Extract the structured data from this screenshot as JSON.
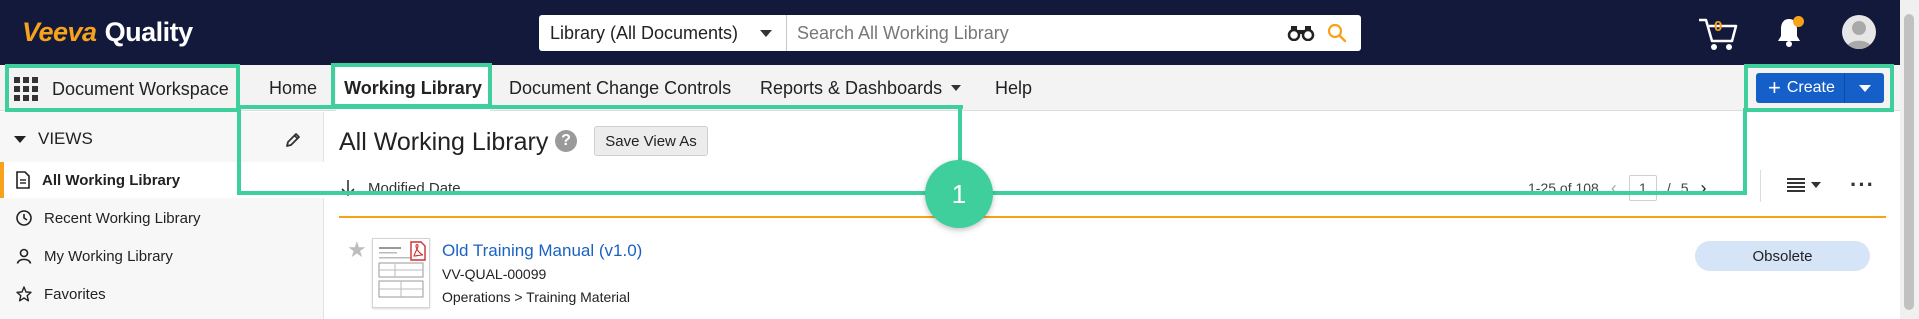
{
  "header": {
    "brand": "Veeva",
    "product": "Quality",
    "search_scope": "Library (All Documents)",
    "search_placeholder": "Search All Working Library",
    "cart_count": "0",
    "accent": "#f7a21b",
    "bg": "#12193a"
  },
  "nav": {
    "workspace_label": "Document Workspace",
    "items": [
      {
        "label": "Home"
      },
      {
        "label": "Working Library"
      },
      {
        "label": "Document Change Controls"
      },
      {
        "label": "Reports & Dashboards"
      },
      {
        "label": "Help"
      }
    ],
    "create_label": "Create"
  },
  "sidebar": {
    "views_label": "VIEWS",
    "items": [
      {
        "label": "All Working Library",
        "icon": "document-icon"
      },
      {
        "label": "Recent Working Library",
        "icon": "clock-icon"
      },
      {
        "label": "My Working Library",
        "icon": "person-icon"
      },
      {
        "label": "Favorites",
        "icon": "star-icon"
      }
    ]
  },
  "main": {
    "title": "All Working Library",
    "save_view_label": "Save View As",
    "sort_label": "Modified Date",
    "pager": {
      "range": "1-25 of 108",
      "current_page": "1",
      "total_pages": "5"
    },
    "documents": [
      {
        "title": "Old Training Manual (v1.0)",
        "number": "VV-QUAL-00099",
        "path": "Operations > Training Material",
        "status": "Obsolete"
      }
    ]
  },
  "annotation": {
    "badge": "1",
    "color": "#3ecf9c"
  }
}
